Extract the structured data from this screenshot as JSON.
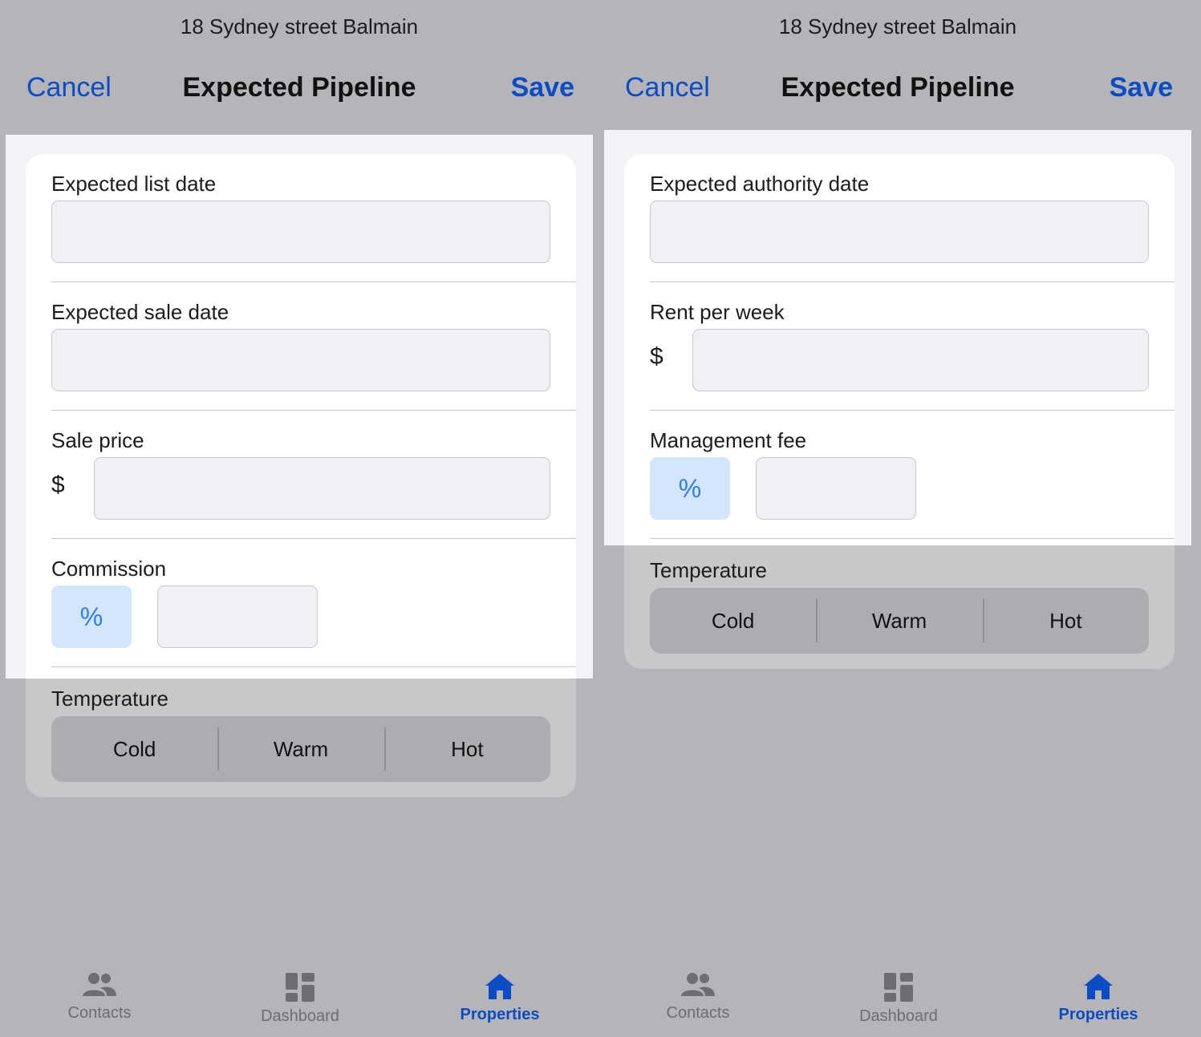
{
  "left": {
    "address": "18 Sydney street Balmain",
    "nav": {
      "cancel": "Cancel",
      "title": "Expected Pipeline",
      "save": "Save"
    },
    "fields": {
      "list_date": "Expected list date",
      "sale_date": "Expected sale date",
      "sale_price": "Sale price",
      "commission": "Commission"
    },
    "currency": "$",
    "percent": "%",
    "temperature": {
      "label": "Temperature",
      "options": [
        "Cold",
        "Warm",
        "Hot"
      ]
    }
  },
  "right": {
    "address": "18 Sydney street Balmain",
    "nav": {
      "cancel": "Cancel",
      "title": "Expected Pipeline",
      "save": "Save"
    },
    "fields": {
      "authority_date": "Expected authority date",
      "rent_per_week": "Rent per week",
      "management_fee": "Management fee"
    },
    "currency": "$",
    "percent": "%",
    "temperature": {
      "label": "Temperature",
      "options": [
        "Cold",
        "Warm",
        "Hot"
      ]
    }
  },
  "tabbar": {
    "items": [
      {
        "label": "Contacts",
        "icon": "contacts-icon"
      },
      {
        "label": "Dashboard",
        "icon": "dashboard-icon"
      },
      {
        "label": "Properties",
        "icon": "home-icon",
        "active": true
      }
    ]
  },
  "colors": {
    "accent": "#0a4cc4",
    "percent_button_bg": "#d3e6fc",
    "percent_text": "#2b7ef0",
    "backdrop": "#b4b4b9"
  }
}
